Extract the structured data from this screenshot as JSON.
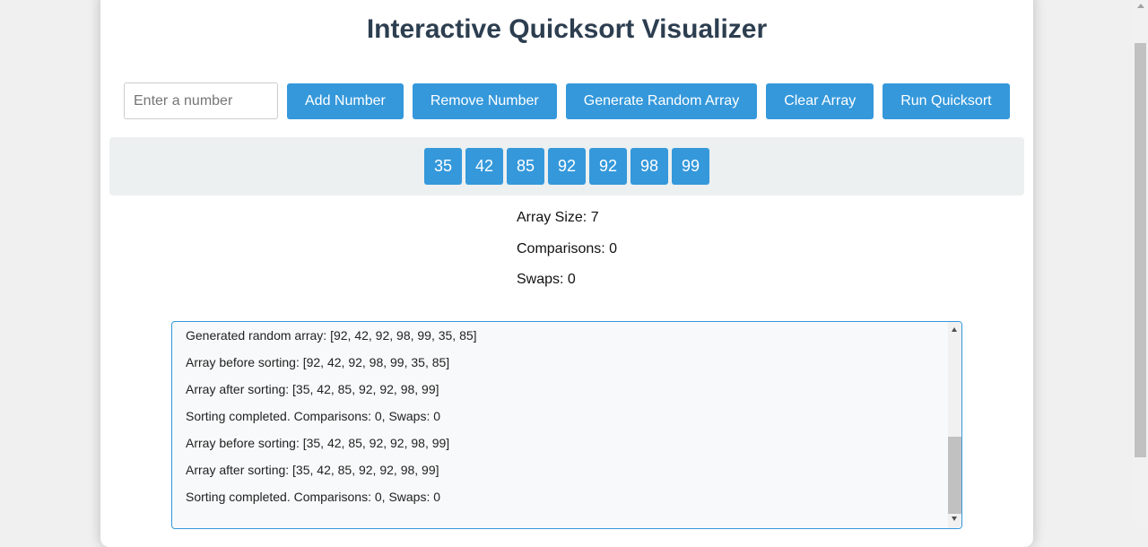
{
  "app": {
    "title": "Interactive Quicksort Visualizer"
  },
  "controls": {
    "number_input": {
      "placeholder": "Enter a number",
      "value": ""
    },
    "buttons": [
      {
        "label": "Add Number"
      },
      {
        "label": "Remove Number"
      },
      {
        "label": "Generate Random Array"
      },
      {
        "label": "Clear Array"
      },
      {
        "label": "Run Quicksort"
      }
    ]
  },
  "array": {
    "elements": [
      "35",
      "42",
      "85",
      "92",
      "92",
      "98",
      "99"
    ]
  },
  "stats": {
    "size": "Array Size: 7",
    "comparisons": "Comparisons: 0",
    "swaps": "Swaps: 0"
  },
  "log": {
    "lines": [
      "Generated random array: [92, 42, 92, 98, 99, 35, 85]",
      "Array before sorting: [92, 42, 92, 98, 99, 35, 85]",
      "Array after sorting: [35, 42, 85, 92, 92, 98, 99]",
      "Sorting completed. Comparisons: 0, Swaps: 0",
      "Array before sorting: [35, 42, 85, 92, 92, 98, 99]",
      "Array after sorting: [35, 42, 85, 92, 92, 98, 99]",
      "Sorting completed. Comparisons: 0, Swaps: 0"
    ]
  },
  "colors": {
    "accent": "#3498db",
    "title": "#2c3e50",
    "array_background": "#ecf0f1",
    "log_background": "#f8f9fa"
  }
}
